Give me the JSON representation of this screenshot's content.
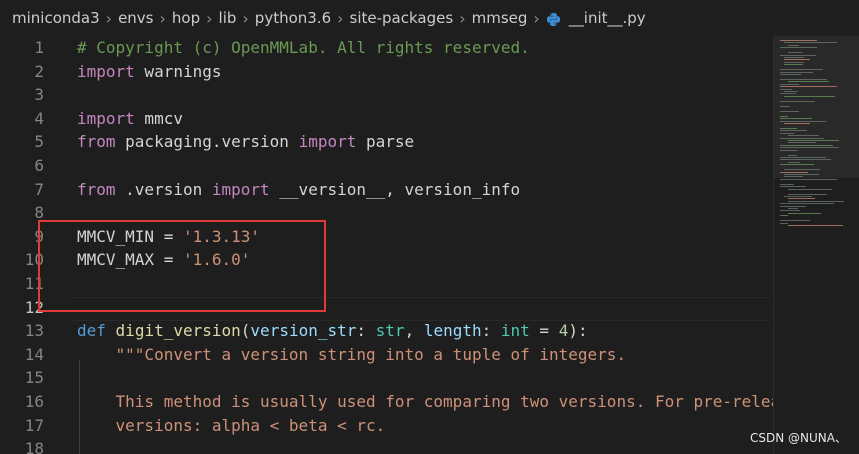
{
  "breadcrumb": {
    "segments": [
      "miniconda3",
      "envs",
      "hop",
      "lib",
      "python3.6",
      "site-packages",
      "mmseg"
    ],
    "file": "__init__.py",
    "file_icon": "python-icon"
  },
  "editor": {
    "current_line": 12,
    "lines": [
      {
        "n": "1",
        "tokens": [
          {
            "t": "# Copyright (c) OpenMMLab. All rights reserved.",
            "c": "comment"
          }
        ]
      },
      {
        "n": "2",
        "tokens": [
          {
            "t": "import",
            "c": "kw"
          },
          {
            "t": " warnings",
            "c": "plain"
          }
        ]
      },
      {
        "n": "3",
        "tokens": []
      },
      {
        "n": "4",
        "tokens": [
          {
            "t": "import",
            "c": "kw"
          },
          {
            "t": " mmcv",
            "c": "plain"
          }
        ]
      },
      {
        "n": "5",
        "tokens": [
          {
            "t": "from",
            "c": "kw"
          },
          {
            "t": " packaging.version ",
            "c": "plain"
          },
          {
            "t": "import",
            "c": "kw"
          },
          {
            "t": " parse",
            "c": "plain"
          }
        ]
      },
      {
        "n": "6",
        "tokens": []
      },
      {
        "n": "7",
        "tokens": [
          {
            "t": "from",
            "c": "kw"
          },
          {
            "t": " .version ",
            "c": "plain"
          },
          {
            "t": "import",
            "c": "kw"
          },
          {
            "t": " __version__, version_info",
            "c": "plain"
          }
        ]
      },
      {
        "n": "8",
        "tokens": []
      },
      {
        "n": "9",
        "tokens": [
          {
            "t": "MMCV_MIN = ",
            "c": "plain"
          },
          {
            "t": "'1.3.13'",
            "c": "str"
          }
        ]
      },
      {
        "n": "10",
        "tokens": [
          {
            "t": "MMCV_MAX = ",
            "c": "plain"
          },
          {
            "t": "'1.6.0'",
            "c": "str"
          }
        ]
      },
      {
        "n": "11",
        "tokens": []
      },
      {
        "n": "12",
        "tokens": []
      },
      {
        "n": "13",
        "tokens": [
          {
            "t": "def",
            "c": "def"
          },
          {
            "t": " ",
            "c": "plain"
          },
          {
            "t": "digit_version",
            "c": "fn"
          },
          {
            "t": "(",
            "c": "plain"
          },
          {
            "t": "version_str",
            "c": "param"
          },
          {
            "t": ": ",
            "c": "plain"
          },
          {
            "t": "str",
            "c": "type"
          },
          {
            "t": ", ",
            "c": "plain"
          },
          {
            "t": "length",
            "c": "param"
          },
          {
            "t": ": ",
            "c": "plain"
          },
          {
            "t": "int",
            "c": "type"
          },
          {
            "t": " = ",
            "c": "plain"
          },
          {
            "t": "4",
            "c": "num"
          },
          {
            "t": "):",
            "c": "plain"
          }
        ]
      },
      {
        "n": "14",
        "tokens": [
          {
            "t": "    \"\"\"Convert a version string into a tuple of integers.",
            "c": "str"
          }
        ]
      },
      {
        "n": "15",
        "tokens": []
      },
      {
        "n": "16",
        "tokens": [
          {
            "t": "    This method is usually used for comparing two versions. For pre-relea",
            "c": "str"
          }
        ]
      },
      {
        "n": "17",
        "tokens": [
          {
            "t": "    versions: alpha < beta < rc.",
            "c": "str"
          }
        ]
      },
      {
        "n": "18",
        "tokens": []
      }
    ]
  },
  "watermark": "CSDN @NUNA、",
  "colors": {
    "background": "#1e1e1e",
    "highlight_box": "#e03a3a",
    "comment": "#6a9955",
    "keyword": "#c586c0",
    "string": "#ce9178"
  }
}
